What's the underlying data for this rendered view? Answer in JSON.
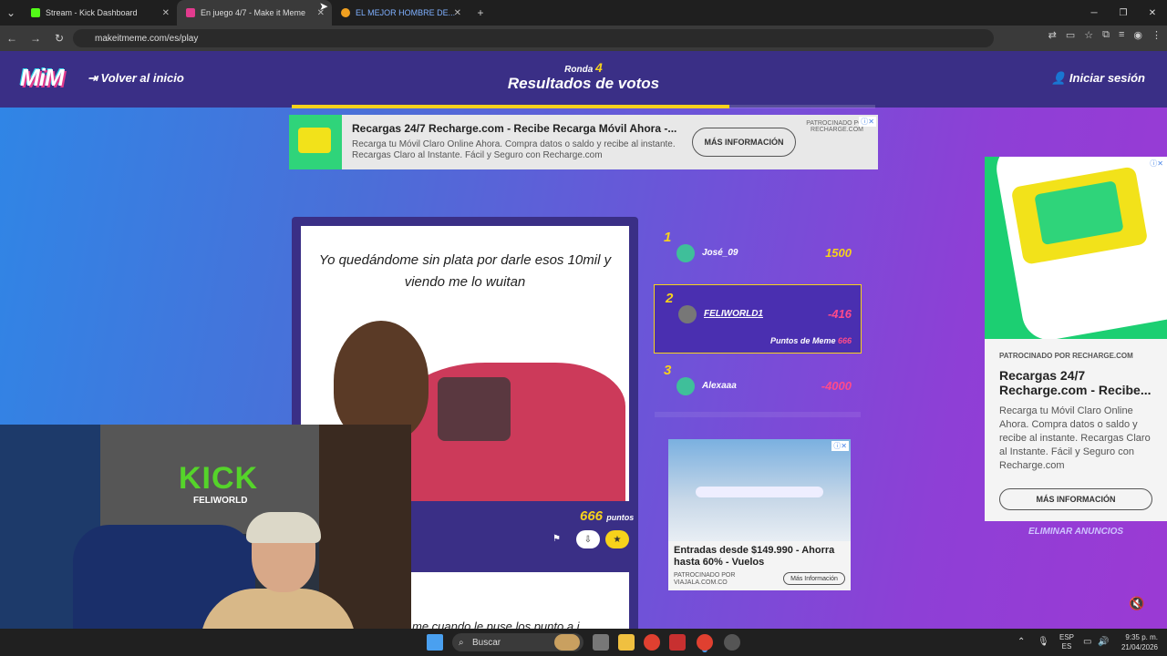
{
  "browser": {
    "tabs": [
      {
        "title": "Stream - Kick Dashboard",
        "icon_color": "#53fc18"
      },
      {
        "title": "En juego 4/7 - Make it Meme",
        "icon_color": "#e23b8e"
      },
      {
        "title": "EL MEJOR HOMBRE DE...",
        "icon_color": "#f0a020"
      }
    ],
    "url": "makeitmeme.com/es/play"
  },
  "header": {
    "logo": "MiM",
    "back_label": "Volver al inicio",
    "round_label": "Ronda",
    "round_number": "4",
    "title": "Resultados de votos",
    "progress": 0.75,
    "login_label": "Iniciar sesión"
  },
  "ad_top": {
    "title": "Recargas 24/7 Recharge.com - Recibe Recarga Móvil Ahora -...",
    "description": "Recarga tu Móvil Claro Online Ahora. Compra datos o saldo y recibe al instante. Recargas Claro al Instante. Fácil y Seguro con Recharge.com",
    "button": "MÁS INFORMACIÓN",
    "sponsor": "PATROCINADO POR RECHARGE.COM"
  },
  "meme": {
    "caption": "Yo quedándome sin plata por darle esos 10mil y viendo me lo wuitan",
    "points": "666",
    "points_unit": "puntos",
    "next_caption": "me cuando le puse los punto a i"
  },
  "leaderboard": [
    {
      "rank": "1",
      "name": "José_09",
      "score": "1500",
      "score_color": "#f7d21b"
    },
    {
      "rank": "2",
      "name": "FELIWORLD1",
      "score": "-416",
      "score_color": "#ff4a8a",
      "sub_label": "Puntos de Meme",
      "sub_value": "666"
    },
    {
      "rank": "3",
      "name": "Alexaaa",
      "score": "-4000",
      "score_color": "#ff4a8a"
    }
  ],
  "ad_mid": {
    "title": "Entradas desde $149.990 - Ahorra hasta 60% - Vuelos",
    "sponsor": "PATROCINADO POR VIAJALA.COM.CO",
    "button": "Más Información"
  },
  "ad_right": {
    "sponsor": "PATROCINADO POR RECHARGE.COM",
    "title": "Recargas 24/7 Recharge.com - Recibe...",
    "description": "Recarga tu Móvil Claro Online Ahora. Compra datos o saldo y recibe al instante. Recargas Claro al Instante. Fácil y Seguro con Recharge.com",
    "button": "MÁS INFORMACIÓN"
  },
  "remove_ads": "ELIMINAR ANUNCIOS",
  "webcam": {
    "brand": "KICK",
    "brand_sub": "FELIWORLD"
  },
  "taskbar": {
    "search": "Buscar",
    "lang1": "ESP",
    "lang2": "ES",
    "time": "9:35 p. m.",
    "date": "21/04/2026"
  }
}
